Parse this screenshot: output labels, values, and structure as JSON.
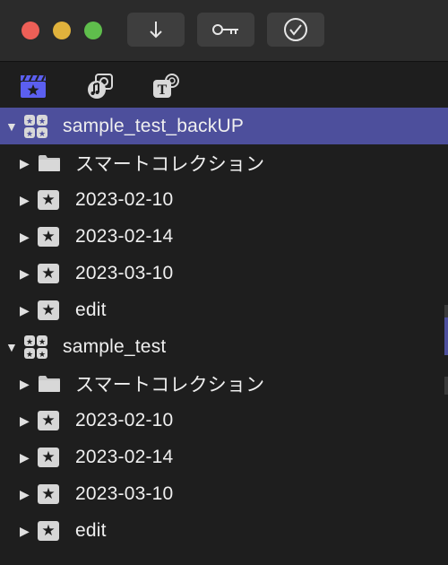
{
  "toolbar": {
    "import_icon": "arrow-down-icon",
    "keyword_icon": "key-icon",
    "analysis_icon": "checkmark-circle-icon"
  },
  "tabs": {
    "libraries_icon": "clapper-star-icon",
    "photos_audio_icon": "photo-music-icon",
    "titles_icon": "titles-t-icon"
  },
  "libraries": [
    {
      "name": "sample_test_backUP",
      "selected": true,
      "items": [
        {
          "type": "folder",
          "label": "スマートコレクション"
        },
        {
          "type": "event",
          "label": "2023-02-10"
        },
        {
          "type": "event",
          "label": "2023-02-14"
        },
        {
          "type": "event",
          "label": "2023-03-10"
        },
        {
          "type": "event",
          "label": "edit"
        }
      ]
    },
    {
      "name": "sample_test",
      "selected": false,
      "items": [
        {
          "type": "folder",
          "label": "スマートコレクション"
        },
        {
          "type": "event",
          "label": "2023-02-10"
        },
        {
          "type": "event",
          "label": "2023-02-14"
        },
        {
          "type": "event",
          "label": "2023-03-10"
        },
        {
          "type": "event",
          "label": "edit"
        }
      ]
    }
  ],
  "colors": {
    "selection": "#4d4f9c",
    "accent_blue": "#5b5ff0"
  }
}
